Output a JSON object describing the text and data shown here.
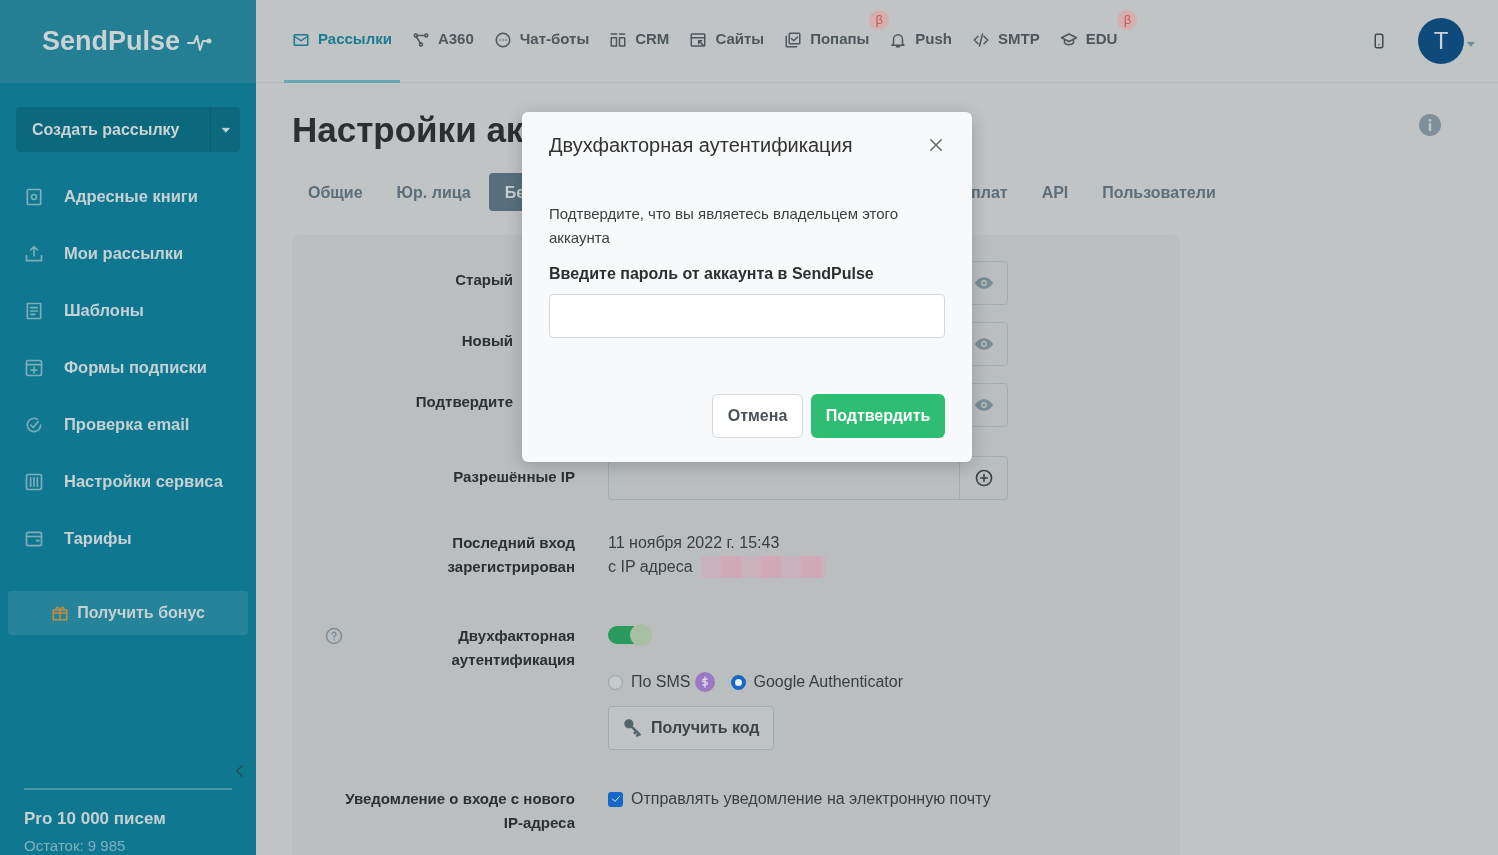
{
  "logo": {
    "text": "SendPulse"
  },
  "nav": [
    {
      "label": "Рассылки",
      "selected": true
    },
    {
      "label": "A360",
      "selected": false
    },
    {
      "label": "Чат-боты",
      "selected": false
    },
    {
      "label": "CRM",
      "selected": false
    },
    {
      "label": "Сайты",
      "selected": false
    },
    {
      "label": "Попапы",
      "selected": false,
      "beta": "β"
    },
    {
      "label": "Push",
      "selected": false
    },
    {
      "label": "SMTP",
      "selected": false
    },
    {
      "label": "EDU",
      "selected": false,
      "beta": "β"
    }
  ],
  "avatar": {
    "letter": "T"
  },
  "sidebar": {
    "create_button": "Создать рассылку",
    "items": [
      {
        "label": "Адресные книги"
      },
      {
        "label": "Мои рассылки"
      },
      {
        "label": "Шаблоны"
      },
      {
        "label": "Формы подписки"
      },
      {
        "label": "Проверка email"
      },
      {
        "label": "Настройки сервиса"
      },
      {
        "label": "Тарифы"
      }
    ],
    "bonus_button": "Получить бонус",
    "plan": "Pro 10 000 писем",
    "remaining": "Остаток: 9 985"
  },
  "page": {
    "title": "Настройки ак",
    "tabs": [
      {
        "label": "Общие",
        "selected": false
      },
      {
        "label": "Юр. лица",
        "selected": false
      },
      {
        "label": "Бе",
        "selected": true
      },
      {
        "label": "плат",
        "selected": false
      },
      {
        "label": "API",
        "selected": false
      },
      {
        "label": "Пользователи",
        "selected": false
      }
    ],
    "password_rows": [
      {
        "label": "Старый"
      },
      {
        "label": "Новый"
      },
      {
        "label": "Подтвердите"
      }
    ],
    "allowed_ip": {
      "label": "Разрешённые IP"
    },
    "last_login": {
      "label": "Последний вход зарегистрирован",
      "date": "11 ноября 2022 г. 15:43",
      "ip_label": "с IP адреса"
    },
    "two_factor": {
      "label": "Двухфакторная аутентификация",
      "on": true,
      "methods": [
        {
          "label": "По SMS",
          "selected": false,
          "paid": true
        },
        {
          "label": "Google Authenticator",
          "selected": true,
          "paid": false
        }
      ],
      "get_code_button": "Получить код"
    },
    "notify": {
      "label": "Уведомление о входе с нового IP-адреса",
      "text": "Отправлять уведомление на электронную почту",
      "checked": true
    }
  },
  "modal": {
    "title": "Двухфакторная аутентификация",
    "message": "Подтвердите, что вы являетесь владельцем этого аккаунта",
    "field_label": "Введите пароль от аккаунта в SendPulse",
    "cancel": "Отмена",
    "confirm": "Подтвердить"
  }
}
